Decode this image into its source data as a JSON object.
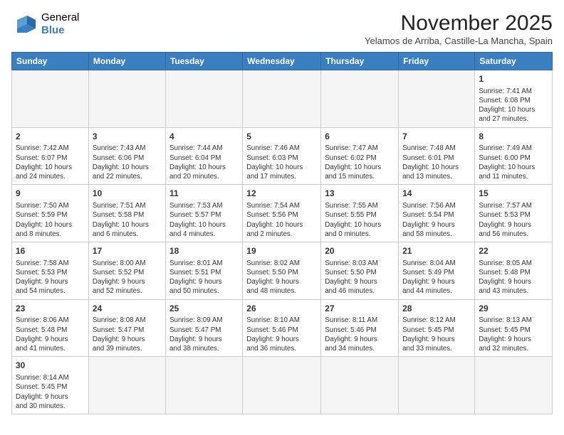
{
  "header": {
    "logo_line1": "General",
    "logo_line2": "Blue",
    "month_title": "November 2025",
    "subtitle": "Yelamos de Arriba, Castille-La Mancha, Spain"
  },
  "weekdays": [
    "Sunday",
    "Monday",
    "Tuesday",
    "Wednesday",
    "Thursday",
    "Friday",
    "Saturday"
  ],
  "weeks": [
    [
      {
        "day": "",
        "info": ""
      },
      {
        "day": "",
        "info": ""
      },
      {
        "day": "",
        "info": ""
      },
      {
        "day": "",
        "info": ""
      },
      {
        "day": "",
        "info": ""
      },
      {
        "day": "",
        "info": ""
      },
      {
        "day": "1",
        "info": "Sunrise: 7:41 AM\nSunset: 6:08 PM\nDaylight: 10 hours\nand 27 minutes."
      }
    ],
    [
      {
        "day": "2",
        "info": "Sunrise: 7:42 AM\nSunset: 6:07 PM\nDaylight: 10 hours\nand 24 minutes."
      },
      {
        "day": "3",
        "info": "Sunrise: 7:43 AM\nSunset: 6:06 PM\nDaylight: 10 hours\nand 22 minutes."
      },
      {
        "day": "4",
        "info": "Sunrise: 7:44 AM\nSunset: 6:04 PM\nDaylight: 10 hours\nand 20 minutes."
      },
      {
        "day": "5",
        "info": "Sunrise: 7:46 AM\nSunset: 6:03 PM\nDaylight: 10 hours\nand 17 minutes."
      },
      {
        "day": "6",
        "info": "Sunrise: 7:47 AM\nSunset: 6:02 PM\nDaylight: 10 hours\nand 15 minutes."
      },
      {
        "day": "7",
        "info": "Sunrise: 7:48 AM\nSunset: 6:01 PM\nDaylight: 10 hours\nand 13 minutes."
      },
      {
        "day": "8",
        "info": "Sunrise: 7:49 AM\nSunset: 6:00 PM\nDaylight: 10 hours\nand 11 minutes."
      }
    ],
    [
      {
        "day": "9",
        "info": "Sunrise: 7:50 AM\nSunset: 5:59 PM\nDaylight: 10 hours\nand 8 minutes."
      },
      {
        "day": "10",
        "info": "Sunrise: 7:51 AM\nSunset: 5:58 PM\nDaylight: 10 hours\nand 6 minutes."
      },
      {
        "day": "11",
        "info": "Sunrise: 7:53 AM\nSunset: 5:57 PM\nDaylight: 10 hours\nand 4 minutes."
      },
      {
        "day": "12",
        "info": "Sunrise: 7:54 AM\nSunset: 5:56 PM\nDaylight: 10 hours\nand 2 minutes."
      },
      {
        "day": "13",
        "info": "Sunrise: 7:55 AM\nSunset: 5:55 PM\nDaylight: 10 hours\nand 0 minutes."
      },
      {
        "day": "14",
        "info": "Sunrise: 7:56 AM\nSunset: 5:54 PM\nDaylight: 9 hours\nand 58 minutes."
      },
      {
        "day": "15",
        "info": "Sunrise: 7:57 AM\nSunset: 5:53 PM\nDaylight: 9 hours\nand 56 minutes."
      }
    ],
    [
      {
        "day": "16",
        "info": "Sunrise: 7:58 AM\nSunset: 5:53 PM\nDaylight: 9 hours\nand 54 minutes."
      },
      {
        "day": "17",
        "info": "Sunrise: 8:00 AM\nSunset: 5:52 PM\nDaylight: 9 hours\nand 52 minutes."
      },
      {
        "day": "18",
        "info": "Sunrise: 8:01 AM\nSunset: 5:51 PM\nDaylight: 9 hours\nand 50 minutes."
      },
      {
        "day": "19",
        "info": "Sunrise: 8:02 AM\nSunset: 5:50 PM\nDaylight: 9 hours\nand 48 minutes."
      },
      {
        "day": "20",
        "info": "Sunrise: 8:03 AM\nSunset: 5:50 PM\nDaylight: 9 hours\nand 46 minutes."
      },
      {
        "day": "21",
        "info": "Sunrise: 8:04 AM\nSunset: 5:49 PM\nDaylight: 9 hours\nand 44 minutes."
      },
      {
        "day": "22",
        "info": "Sunrise: 8:05 AM\nSunset: 5:48 PM\nDaylight: 9 hours\nand 43 minutes."
      }
    ],
    [
      {
        "day": "23",
        "info": "Sunrise: 8:06 AM\nSunset: 5:48 PM\nDaylight: 9 hours\nand 41 minutes."
      },
      {
        "day": "24",
        "info": "Sunrise: 8:08 AM\nSunset: 5:47 PM\nDaylight: 9 hours\nand 39 minutes."
      },
      {
        "day": "25",
        "info": "Sunrise: 8:09 AM\nSunset: 5:47 PM\nDaylight: 9 hours\nand 38 minutes."
      },
      {
        "day": "26",
        "info": "Sunrise: 8:10 AM\nSunset: 5:46 PM\nDaylight: 9 hours\nand 36 minutes."
      },
      {
        "day": "27",
        "info": "Sunrise: 8:11 AM\nSunset: 5:46 PM\nDaylight: 9 hours\nand 34 minutes."
      },
      {
        "day": "28",
        "info": "Sunrise: 8:12 AM\nSunset: 5:45 PM\nDaylight: 9 hours\nand 33 minutes."
      },
      {
        "day": "29",
        "info": "Sunrise: 8:13 AM\nSunset: 5:45 PM\nDaylight: 9 hours\nand 32 minutes."
      }
    ],
    [
      {
        "day": "30",
        "info": "Sunrise: 8:14 AM\nSunset: 5:45 PM\nDaylight: 9 hours\nand 30 minutes."
      },
      {
        "day": "",
        "info": ""
      },
      {
        "day": "",
        "info": ""
      },
      {
        "day": "",
        "info": ""
      },
      {
        "day": "",
        "info": ""
      },
      {
        "day": "",
        "info": ""
      },
      {
        "day": "",
        "info": ""
      }
    ]
  ]
}
